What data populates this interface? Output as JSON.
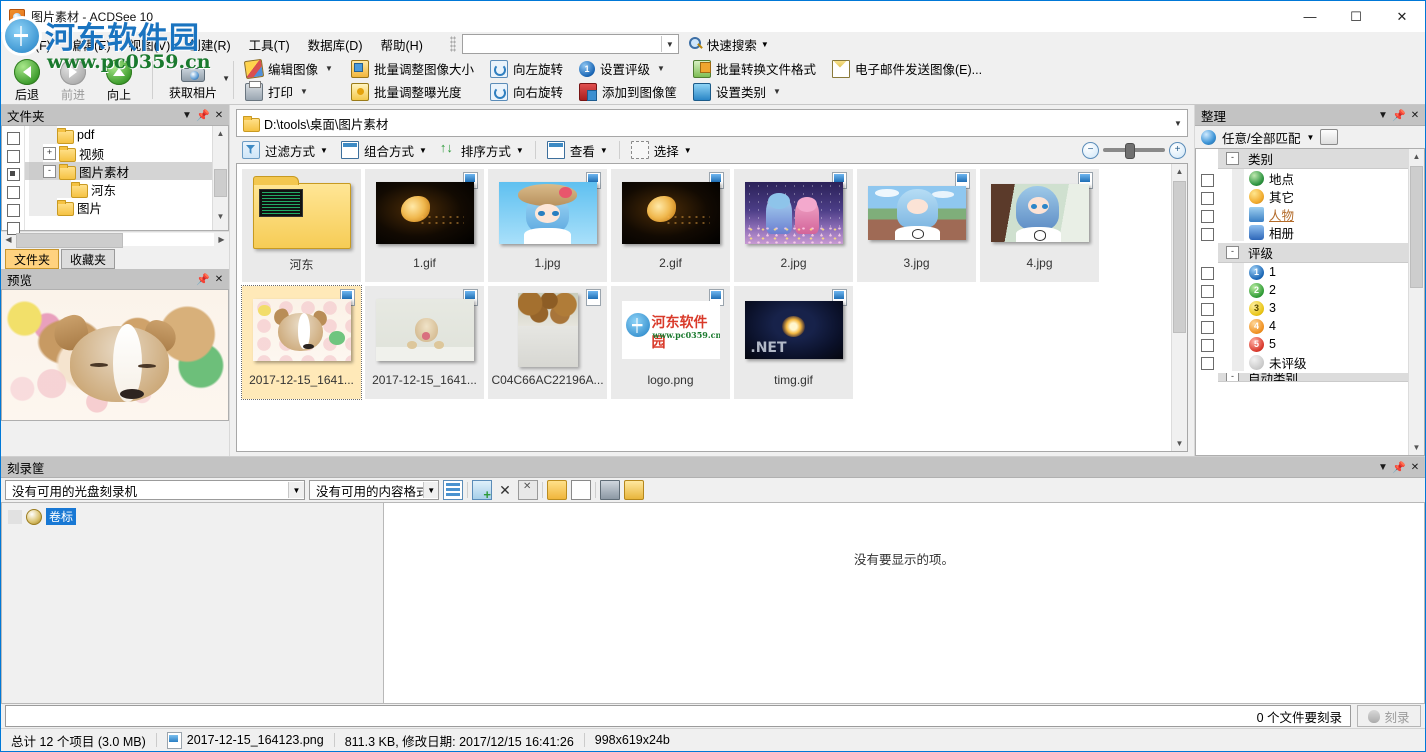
{
  "window": {
    "title": "图片素材 - ACDSee 10",
    "minimize": "—",
    "maximize": "☐",
    "close": "✕"
  },
  "watermark": {
    "line1": "河东软件园",
    "line2": "www.pc0359.cn"
  },
  "menu": {
    "items": [
      "文件(F)",
      "编辑(E)",
      "视图(V)",
      "创建(R)",
      "工具(T)",
      "数据库(D)",
      "帮助(H)"
    ],
    "quick_search_value": "",
    "quick_search_label": "快速搜索"
  },
  "toolbar": {
    "back": "后退",
    "forward": "前进",
    "up": "向上",
    "get_photos": "获取相片",
    "edit_image": "编辑图像",
    "print": "打印",
    "batch_resize": "批量调整图像大小",
    "batch_exposure": "批量调整曝光度",
    "rotate_left": "向左旋转",
    "rotate_right": "向右旋转",
    "set_rating": "设置评级",
    "rating_number": "1",
    "add_to_basket": "添加到图像筐",
    "batch_convert": "批量转换文件格式",
    "set_category": "设置类别",
    "email_image": "电子邮件发送图像(E)..."
  },
  "folders_pane": {
    "title": "文件夹",
    "tree": [
      {
        "label": "pdf",
        "indent": 2,
        "expander": "",
        "selected": false
      },
      {
        "label": "视频",
        "indent": 1,
        "expander": "+",
        "selected": false
      },
      {
        "label": "图片素材",
        "indent": 1,
        "expander": "-",
        "selected": true
      },
      {
        "label": "河东",
        "indent": 3,
        "expander": "",
        "selected": false
      },
      {
        "label": "图片",
        "indent": 1,
        "expander": "",
        "selected": false
      }
    ],
    "tabs": [
      {
        "label": "文件夹",
        "active": true
      },
      {
        "label": "收藏夹",
        "active": false
      }
    ]
  },
  "preview_pane": {
    "title": "预览"
  },
  "address_bar": {
    "path": "D:\\tools\\桌面\\图片素材"
  },
  "list_toolbar": {
    "filter": "过滤方式",
    "group": "组合方式",
    "sort": "排序方式",
    "view": "查看",
    "select": "选择"
  },
  "thumbnails": [
    {
      "name": "河东",
      "kind": "folder",
      "selected": false,
      "badge": false
    },
    {
      "name": "1.gif",
      "kind": "gif-flame",
      "selected": false,
      "badge": true
    },
    {
      "name": "1.jpg",
      "kind": "rem-hat",
      "selected": false,
      "badge": true
    },
    {
      "name": "2.gif",
      "kind": "gif-flame",
      "selected": false,
      "badge": true
    },
    {
      "name": "2.jpg",
      "kind": "two-girls",
      "selected": false,
      "badge": true
    },
    {
      "name": "3.jpg",
      "kind": "rem-sky",
      "selected": false,
      "badge": true
    },
    {
      "name": "4.jpg",
      "kind": "rem-room",
      "selected": false,
      "badge": true
    },
    {
      "name": "2017-12-15_1641...",
      "kind": "corgi",
      "selected": true,
      "badge": true
    },
    {
      "name": "2017-12-15_1641...",
      "kind": "dog2",
      "selected": false,
      "badge": true
    },
    {
      "name": "C04C66AC22196A...",
      "kind": "nuts",
      "selected": false,
      "badge": true
    },
    {
      "name": "logo.png",
      "kind": "logo",
      "selected": false,
      "badge": true
    },
    {
      "name": "timg.gif",
      "kind": "firework",
      "selected": false,
      "badge": true
    }
  ],
  "organize_pane": {
    "title": "整理",
    "match_label": "任意/全部匹配",
    "groups": [
      {
        "title": "类别",
        "items": [
          {
            "label": "地点",
            "icon": "place-icon",
            "link": false
          },
          {
            "label": "其它",
            "icon": "other-icon",
            "link": false
          },
          {
            "label": "人物",
            "icon": "people-icon",
            "link": true
          },
          {
            "label": "相册",
            "icon": "album-icon",
            "link": false
          }
        ]
      },
      {
        "title": "评级",
        "items": [
          {
            "label": "1",
            "rating": "1"
          },
          {
            "label": "2",
            "rating": "2"
          },
          {
            "label": "3",
            "rating": "3"
          },
          {
            "label": "4",
            "rating": "4"
          },
          {
            "label": "5",
            "rating": "5"
          },
          {
            "label": "未评级",
            "rating": ""
          }
        ]
      }
    ],
    "next_group_partial": "自动类别"
  },
  "burn_basket": {
    "title": "刻录筐",
    "burner_select": "没有可用的光盘刻录机",
    "format_select": "没有可用的内容格式",
    "volume_label": "卷标",
    "empty_message": "没有要显示的项。",
    "files_to_burn": "0 个文件要刻录",
    "burn_button": "刻录"
  },
  "status_bar": {
    "total": "总计 12 个项目 (3.0 MB)",
    "file_name": "2017-12-15_164123.png",
    "file_info": "811.3 KB, 修改日期: 2017/12/15 16:41:26",
    "dimensions": "998x619x24b"
  }
}
